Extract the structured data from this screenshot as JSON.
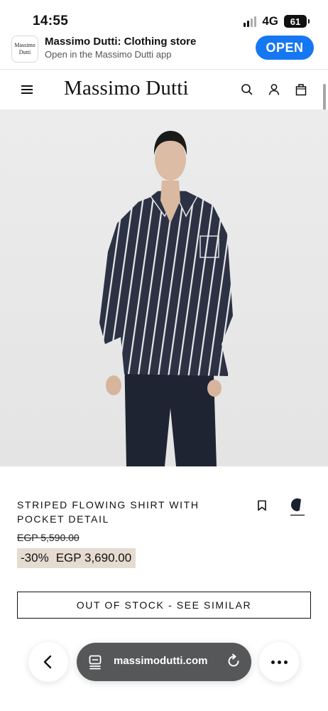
{
  "status_bar": {
    "time": "14:55",
    "network": "4G",
    "battery": "61"
  },
  "app_banner": {
    "logo_line1": "Massimo",
    "logo_line2": "Dutti",
    "title": "Massimo Dutti: Clothing store",
    "subtitle": "Open in the Massimo Dutti app",
    "open_label": "OPEN",
    "open_color": "#1677f2"
  },
  "header": {
    "brand": "Massimo Dutti",
    "icons": [
      "menu-icon",
      "search-icon",
      "user-icon",
      "bag-icon"
    ]
  },
  "product": {
    "image_alt": "Model wearing a navy and white striped shirt with dark jeans",
    "name": "STRIPED FLOWING SHIRT WITH POCKET DETAIL",
    "old_price": "EGP 5,590.00",
    "discount": "-30%",
    "price": "EGP 3,690.00",
    "discount_bg": "#e5dbd0",
    "stock_button": "OUT OF STOCK - SEE SIMILAR"
  },
  "browser": {
    "url": "massimodutti.com",
    "bar_color": "#555758"
  }
}
